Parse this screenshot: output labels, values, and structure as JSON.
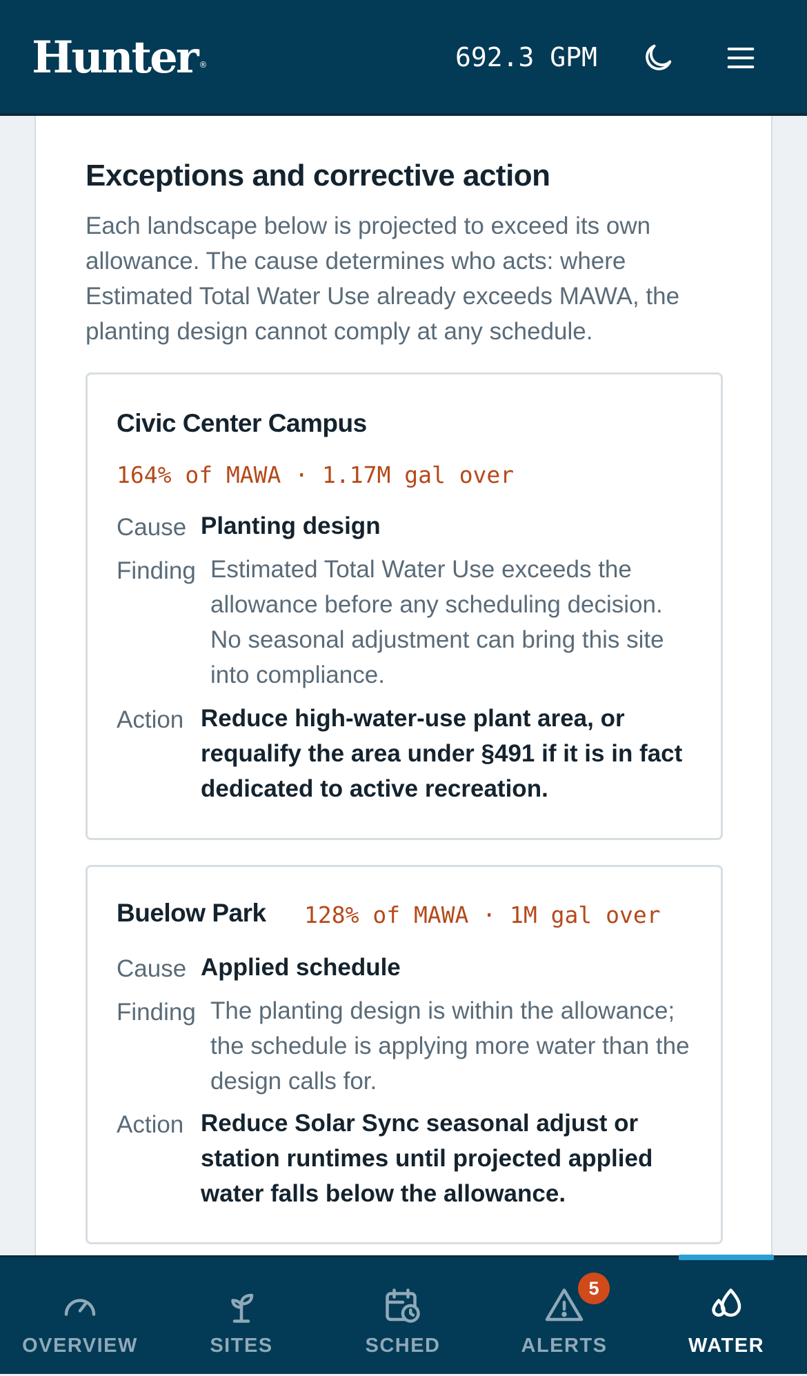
{
  "header": {
    "brand": "Hunter",
    "flow_rate": "692.3 GPM",
    "icons": {
      "theme": "moon-icon",
      "menu": "hamburger-menu-icon"
    }
  },
  "section": {
    "title": "Exceptions and corrective action",
    "description": "Each landscape below is projected to exceed its own allowance. The cause determines who acts: where Estimated Total Water Use already exceeds MAWA, the planting design cannot comply at any schedule."
  },
  "cards": [
    {
      "site": "Civic Center Campus",
      "overage": "164% of MAWA · 1.17M gal over",
      "cause_label": "Cause",
      "cause": "Planting design",
      "finding_label": "Finding",
      "finding": "Estimated Total Water Use exceeds the allowance before any scheduling decision. No seasonal adjustment can bring this site into compliance.",
      "action_label": "Action",
      "action": "Reduce high-water-use plant area, or requalify the area under §491 if it is in fact dedicated to active recreation."
    },
    {
      "site": "Buelow Park",
      "overage": "128% of MAWA · 1M gal over",
      "cause_label": "Cause",
      "cause": "Applied schedule",
      "finding_label": "Finding",
      "finding": "The planting design is within the allowance; the schedule is applying more water than the design calls for.",
      "action_label": "Action",
      "action": "Reduce Solar Sync seasonal adjust or station runtimes until projected applied water falls below the allowance."
    }
  ],
  "nav": {
    "items": [
      {
        "label": "OVERVIEW",
        "icon": "gauge-icon"
      },
      {
        "label": "SITES",
        "icon": "sprout-icon"
      },
      {
        "label": "SCHED",
        "icon": "calendar-clock-icon"
      },
      {
        "label": "ALERTS",
        "icon": "warning-icon",
        "badge": "5"
      },
      {
        "label": "WATER",
        "icon": "droplets-icon",
        "active": true
      }
    ]
  },
  "colors": {
    "header_bg": "#033a55",
    "accent": "#2a9fd6",
    "overage_text": "#b5491a",
    "badge": "#d14a1a"
  }
}
